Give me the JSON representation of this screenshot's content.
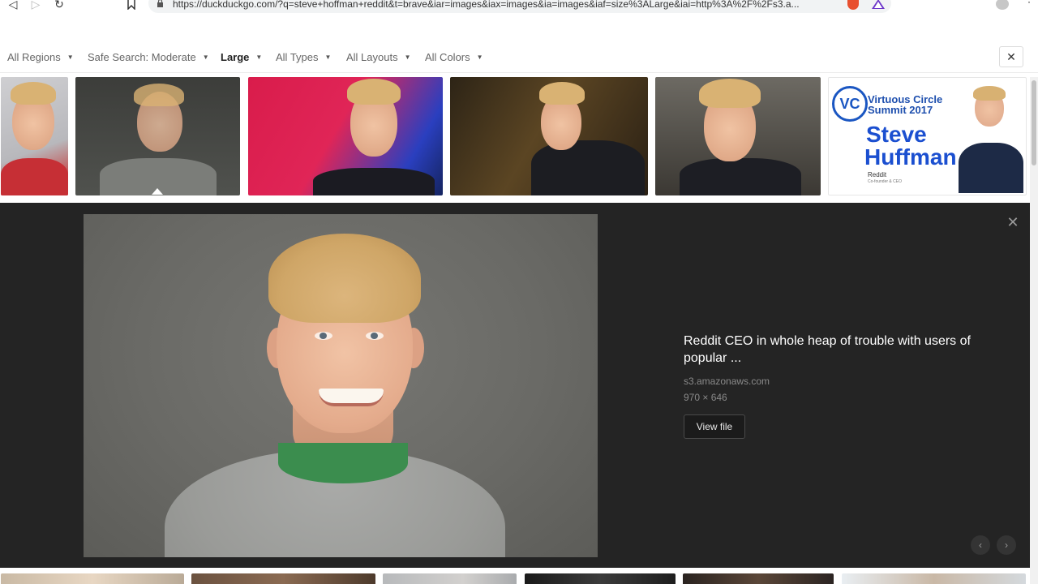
{
  "browser": {
    "url": "https://duckduckgo.com/?q=steve+hoffman+reddit&t=brave&iar=images&iax=images&ia=images&iaf=size%3ALarge&iai=http%3A%2F%2Fs3.a...",
    "icons": [
      "back-icon",
      "forward-icon",
      "reload-icon",
      "bookmark-icon",
      "lock-icon",
      "brave-shield-icon",
      "brave-rewards-icon",
      "profile-icon",
      "menu-icon"
    ]
  },
  "filters": {
    "items": [
      {
        "label": "All Regions",
        "active": false
      },
      {
        "label": "Safe Search: Moderate",
        "active": false
      },
      {
        "label": "Large",
        "active": true
      },
      {
        "label": "All Types",
        "active": false
      },
      {
        "label": "All Layouts",
        "active": false
      },
      {
        "label": "All Colors",
        "active": false
      }
    ],
    "close_glyph": "✕"
  },
  "thumbnails": {
    "selected_index": 1,
    "vc_card": {
      "logo": "VC",
      "title": "Virtuous Circle Summit 2017",
      "name_line1": "Steve",
      "name_line2": "Huffman",
      "company": "Reddit",
      "role": "Co-founder & CEO"
    }
  },
  "detail": {
    "title": "Reddit CEO in whole heap of trouble with users of popular ...",
    "source": "s3.amazonaws.com",
    "dimensions": "970 × 646",
    "view_file_label": "View file",
    "close_glyph": "✕",
    "prev_glyph": "‹",
    "next_glyph": "›"
  },
  "colors": {
    "panel_bg": "#242424",
    "vc_blue": "#1b4fd0"
  }
}
